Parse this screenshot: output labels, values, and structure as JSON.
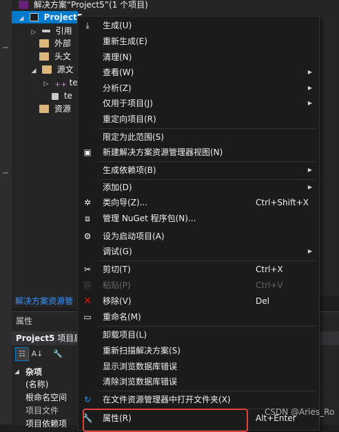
{
  "solution_title": "解决方案“Project5”(1 个项目)",
  "tree": {
    "project": "Project5",
    "items": [
      "引用",
      "外部",
      "头文",
      "源文",
      "te",
      "te",
      "资源"
    ]
  },
  "footer_link": "解决方案资源管",
  "props": {
    "title": "属性",
    "subject_bold": "Project5",
    "subject_rest": " 项目属",
    "section": "杂项",
    "rows": [
      "(名称)",
      "根命名空间",
      "项目文件",
      "项目依赖项"
    ]
  },
  "menu": {
    "items": [
      {
        "label": "生成(U)"
      },
      {
        "label": "重新生成(E)"
      },
      {
        "label": "清理(N)"
      },
      {
        "label": "查看(W)",
        "submenu": true
      },
      {
        "label": "分析(Z)",
        "submenu": true
      },
      {
        "label": "仅用于项目(J)",
        "submenu": true
      },
      {
        "label": "重定向项目(R)"
      },
      {
        "label": "限定为此范围(S)"
      },
      {
        "label": "新建解决方案资源管理器视图(N)"
      },
      {
        "label": "生成依赖项(B)",
        "submenu": true
      },
      {
        "label": "添加(D)",
        "submenu": true
      },
      {
        "label": "类向导(Z)...",
        "shortcut": "Ctrl+Shift+X"
      },
      {
        "label": "管理 NuGet 程序包(N)..."
      },
      {
        "label": "设为启动项目(A)"
      },
      {
        "label": "调试(G)",
        "submenu": true
      },
      {
        "label": "剪切(T)",
        "shortcut": "Ctrl+X"
      },
      {
        "label": "粘贴(P)",
        "shortcut": "Ctrl+V",
        "disabled": true
      },
      {
        "label": "移除(V)",
        "shortcut": "Del"
      },
      {
        "label": "重命名(M)"
      },
      {
        "label": "卸载项目(L)"
      },
      {
        "label": "重新扫描解决方案(S)"
      },
      {
        "label": "显示浏览数据库错误"
      },
      {
        "label": "清除浏览数据库错误"
      },
      {
        "label": "在文件资源管理器中打开文件夹(X)"
      },
      {
        "label": "属性(R)",
        "shortcut": "Alt+Enter"
      }
    ]
  },
  "watermark": "CSDN @Aries_Ro",
  "colors": {
    "accent": "#007acc",
    "highlight_box": "#e0443a",
    "remove_icon": "#e51400"
  }
}
